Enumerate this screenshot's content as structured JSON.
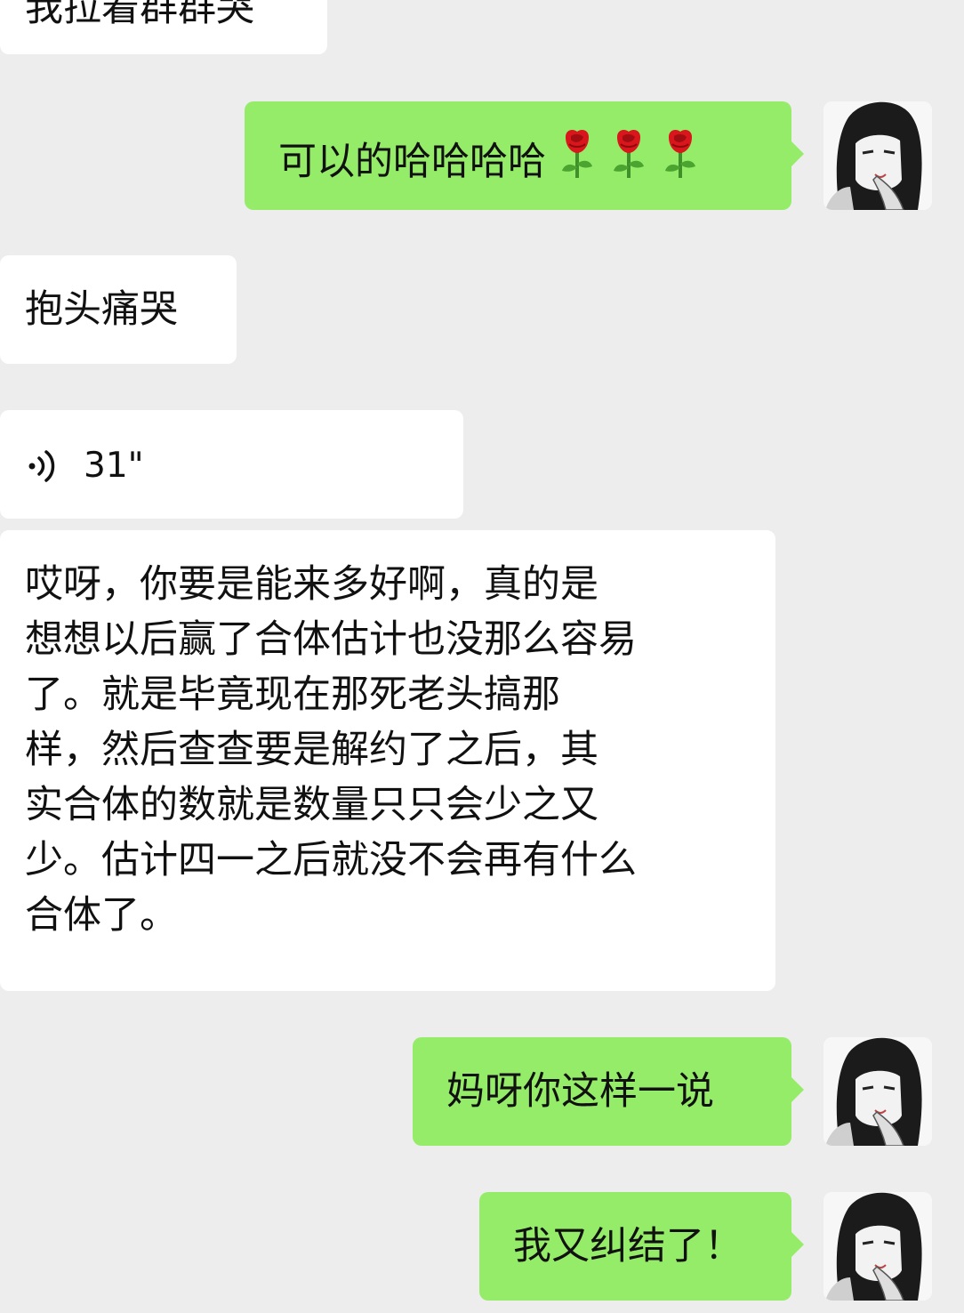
{
  "colors": {
    "background": "#ededed",
    "incoming_bubble": "#ffffff",
    "outgoing_bubble": "#95ec69",
    "text": "#111111"
  },
  "messages": [
    {
      "direction": "incoming",
      "type": "text",
      "text": "我拉着群群哭"
    },
    {
      "direction": "outgoing",
      "type": "text",
      "text": "可以的哈哈哈哈",
      "emoji": [
        "rose-emoji",
        "rose-emoji",
        "rose-emoji"
      ]
    },
    {
      "direction": "incoming",
      "type": "text",
      "text": "抱头痛哭"
    },
    {
      "direction": "incoming",
      "type": "voice",
      "duration": "31\"",
      "icon": "voice-wave-icon"
    },
    {
      "direction": "incoming",
      "type": "text",
      "lines": [
        "哎呀，你要是能来多好啊，真的是",
        "想想以后赢了合体估计也没那么容易",
        "了。就是毕竟现在那死老头搞那",
        "样，然后查查要是解约了之后，其",
        "实合体的数就是数量只只会少之又",
        "少。估计四一之后就没不会再有什么",
        "合体了。"
      ]
    },
    {
      "direction": "outgoing",
      "type": "text",
      "text": "妈呀你这样一说"
    },
    {
      "direction": "outgoing",
      "type": "text",
      "text": "我又纠结了！"
    }
  ],
  "avatar": {
    "icon": "user-avatar-icon"
  }
}
